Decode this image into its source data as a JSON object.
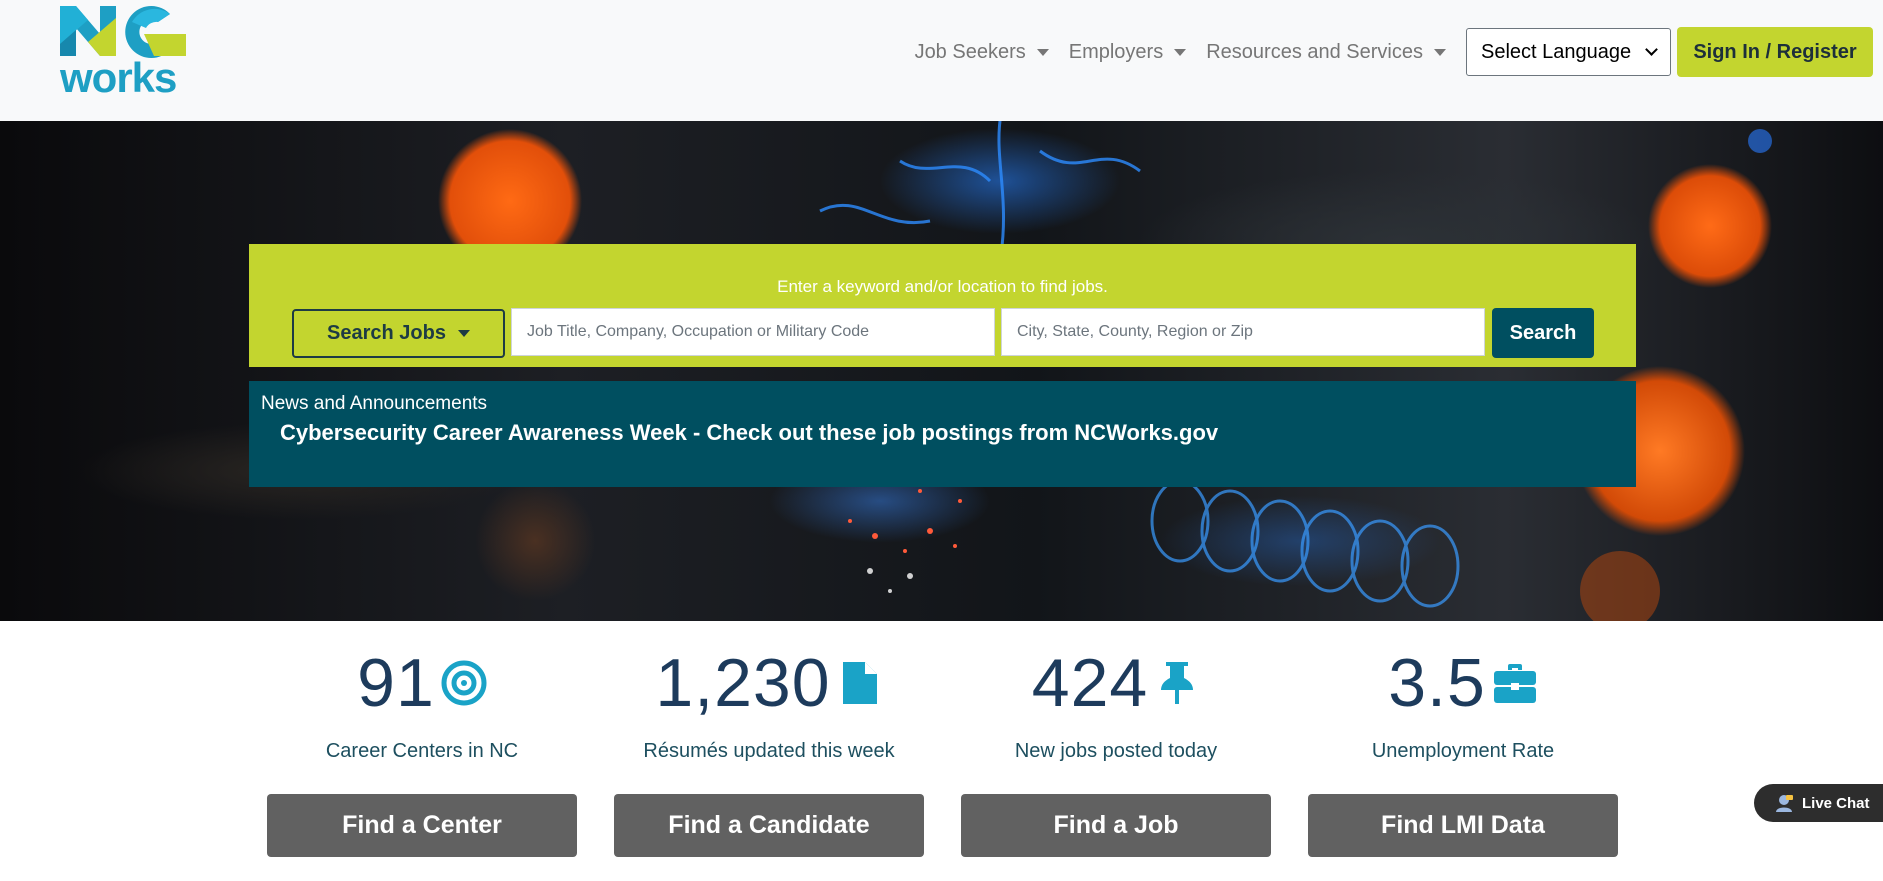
{
  "header": {
    "logo": {
      "line1": "NC",
      "line2": "works"
    },
    "nav": [
      {
        "label": "Job Seekers"
      },
      {
        "label": "Employers"
      },
      {
        "label": "Resources and Services"
      }
    ],
    "language_select": {
      "selected": "Select Language"
    },
    "signin_label": "Sign In / Register"
  },
  "search": {
    "hint": "Enter a keyword and/or location to find jobs.",
    "type_button": "Search Jobs",
    "keyword_placeholder": "Job Title, Company, Occupation or Military Code",
    "location_placeholder": "City, State, County, Region or Zip",
    "button": "Search"
  },
  "news": {
    "heading": "News and Announcements",
    "item": "Cybersecurity Career Awareness Week - Check out these job postings from NCWorks.gov"
  },
  "stats": [
    {
      "value": "91",
      "icon": "target-icon",
      "label": "Career Centers in NC",
      "button": "Find a Center"
    },
    {
      "value": "1,230",
      "icon": "file-icon",
      "label": "Résumés updated this week",
      "button": "Find a Candidate"
    },
    {
      "value": "424",
      "icon": "pushpin-icon",
      "label": "New jobs posted today",
      "button": "Find a Job"
    },
    {
      "value": "3.5",
      "icon": "briefcase-icon",
      "label": "Unemployment Rate",
      "button": "Find LMI Data"
    }
  ],
  "live_chat": {
    "label": "Live Chat"
  },
  "colors": {
    "accent_green": "#c3d52f",
    "teal": "#004f60",
    "logo_blue": "#1e9fc4",
    "stat_number": "#1d3b5c",
    "button_gray": "#616161"
  }
}
